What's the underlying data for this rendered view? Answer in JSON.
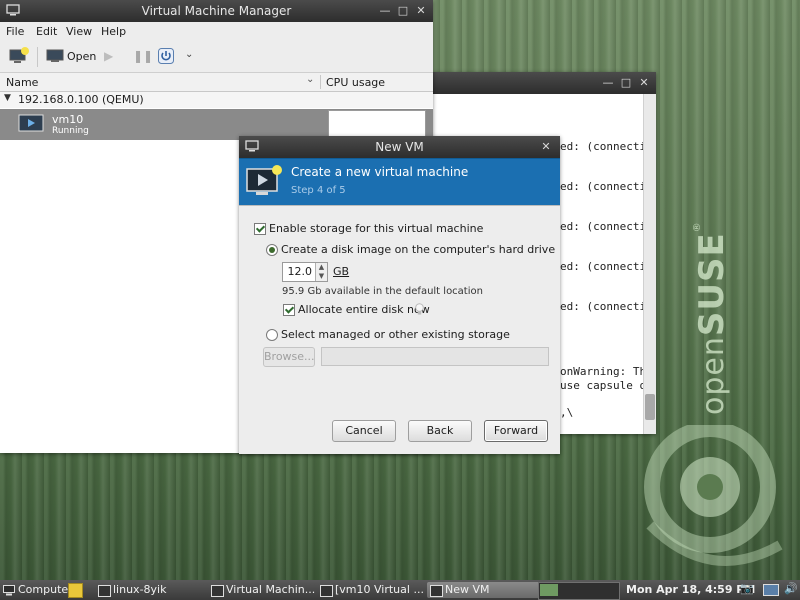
{
  "vmm": {
    "title": "Virtual Machine Manager",
    "menu": {
      "file": "File",
      "edit": "Edit",
      "view": "View",
      "help": "Help"
    },
    "toolbar": {
      "open_label": "Open"
    },
    "columns": {
      "name": "Name",
      "cpu": "CPU usage"
    },
    "host": "192.168.0.100 (QEMU)",
    "vm": {
      "name": "vm10",
      "status": "Running"
    }
  },
  "terminal": {
    "lines": [
      "ed: (connecti",
      "ed: (connecti",
      "ed: (connecti",
      "ed: (connecti",
      "ed: (connecti",
      "onWarning: The",
      "use capsule o",
      ",\\"
    ]
  },
  "dialog": {
    "title": "New VM",
    "header": "Create a new virtual machine",
    "step": "Step 4 of 5",
    "enable_storage": "Enable storage for this virtual machine",
    "create_disk": "Create a disk image on the computer's hard drive",
    "disk_size": "12.0",
    "unit": "GB",
    "available": "95.9 Gb available in the default location",
    "allocate": "Allocate entire disk now",
    "select_managed": "Select managed or other existing storage",
    "browse": "Browse...",
    "path_value": "",
    "buttons": {
      "cancel": "Cancel",
      "back": "Back",
      "forward": "Forward"
    }
  },
  "desktop": {
    "brand_open": "open",
    "brand_suse": "SUSE",
    "brand_mark": "®"
  },
  "taskbar": {
    "computer": "Computer",
    "tasks": [
      {
        "label": "linux-8yik"
      },
      {
        "label": "Virtual Machin..."
      },
      {
        "label": "[vm10 Virtual ..."
      },
      {
        "label": "New VM"
      }
    ],
    "clock": "Mon Apr 18,  4:59 PM"
  },
  "colors": {
    "accent": "#1b6fb1",
    "desktop": "#5f7c55",
    "titlebar": "#3a3a3a"
  }
}
